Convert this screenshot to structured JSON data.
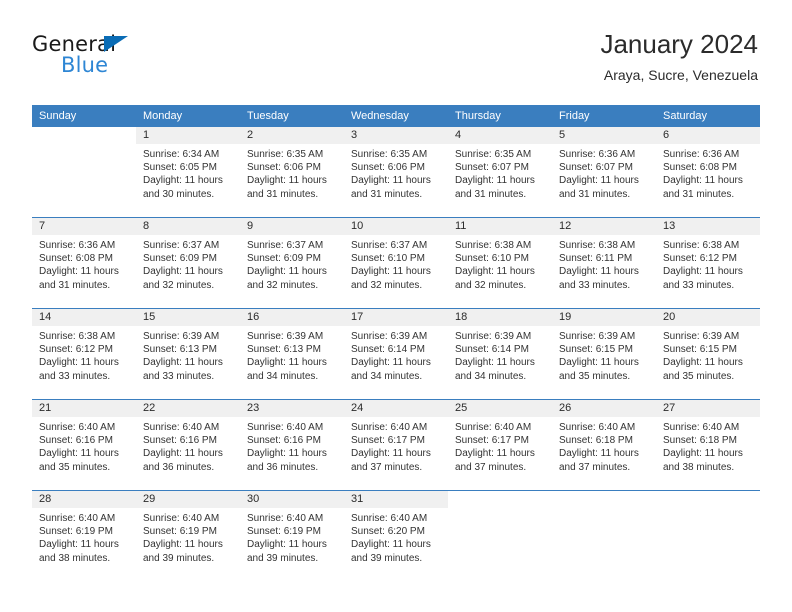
{
  "brand": {
    "name_top": "General",
    "name_bottom": "Blue",
    "triangle_color": "#0a6cb5",
    "blue_color": "#2e86d4"
  },
  "header": {
    "title": "January 2024",
    "subtitle": "Araya, Sucre, Venezuela"
  },
  "theme": {
    "header_row_bg": "#3a7ebf",
    "daynum_bg": "#f0f0f0",
    "grid_line": "#3a7ebf"
  },
  "weekdays": [
    "Sunday",
    "Monday",
    "Tuesday",
    "Wednesday",
    "Thursday",
    "Friday",
    "Saturday"
  ],
  "weeks": [
    [
      {
        "day": "",
        "sunrise": "",
        "sunset": "",
        "daylight1": "",
        "daylight2": "",
        "blank": true
      },
      {
        "day": "1",
        "sunrise": "Sunrise: 6:34 AM",
        "sunset": "Sunset: 6:05 PM",
        "daylight1": "Daylight: 11 hours",
        "daylight2": "and 30 minutes."
      },
      {
        "day": "2",
        "sunrise": "Sunrise: 6:35 AM",
        "sunset": "Sunset: 6:06 PM",
        "daylight1": "Daylight: 11 hours",
        "daylight2": "and 31 minutes."
      },
      {
        "day": "3",
        "sunrise": "Sunrise: 6:35 AM",
        "sunset": "Sunset: 6:06 PM",
        "daylight1": "Daylight: 11 hours",
        "daylight2": "and 31 minutes."
      },
      {
        "day": "4",
        "sunrise": "Sunrise: 6:35 AM",
        "sunset": "Sunset: 6:07 PM",
        "daylight1": "Daylight: 11 hours",
        "daylight2": "and 31 minutes."
      },
      {
        "day": "5",
        "sunrise": "Sunrise: 6:36 AM",
        "sunset": "Sunset: 6:07 PM",
        "daylight1": "Daylight: 11 hours",
        "daylight2": "and 31 minutes."
      },
      {
        "day": "6",
        "sunrise": "Sunrise: 6:36 AM",
        "sunset": "Sunset: 6:08 PM",
        "daylight1": "Daylight: 11 hours",
        "daylight2": "and 31 minutes."
      }
    ],
    [
      {
        "day": "7",
        "sunrise": "Sunrise: 6:36 AM",
        "sunset": "Sunset: 6:08 PM",
        "daylight1": "Daylight: 11 hours",
        "daylight2": "and 31 minutes."
      },
      {
        "day": "8",
        "sunrise": "Sunrise: 6:37 AM",
        "sunset": "Sunset: 6:09 PM",
        "daylight1": "Daylight: 11 hours",
        "daylight2": "and 32 minutes."
      },
      {
        "day": "9",
        "sunrise": "Sunrise: 6:37 AM",
        "sunset": "Sunset: 6:09 PM",
        "daylight1": "Daylight: 11 hours",
        "daylight2": "and 32 minutes."
      },
      {
        "day": "10",
        "sunrise": "Sunrise: 6:37 AM",
        "sunset": "Sunset: 6:10 PM",
        "daylight1": "Daylight: 11 hours",
        "daylight2": "and 32 minutes."
      },
      {
        "day": "11",
        "sunrise": "Sunrise: 6:38 AM",
        "sunset": "Sunset: 6:10 PM",
        "daylight1": "Daylight: 11 hours",
        "daylight2": "and 32 minutes."
      },
      {
        "day": "12",
        "sunrise": "Sunrise: 6:38 AM",
        "sunset": "Sunset: 6:11 PM",
        "daylight1": "Daylight: 11 hours",
        "daylight2": "and 33 minutes."
      },
      {
        "day": "13",
        "sunrise": "Sunrise: 6:38 AM",
        "sunset": "Sunset: 6:12 PM",
        "daylight1": "Daylight: 11 hours",
        "daylight2": "and 33 minutes."
      }
    ],
    [
      {
        "day": "14",
        "sunrise": "Sunrise: 6:38 AM",
        "sunset": "Sunset: 6:12 PM",
        "daylight1": "Daylight: 11 hours",
        "daylight2": "and 33 minutes."
      },
      {
        "day": "15",
        "sunrise": "Sunrise: 6:39 AM",
        "sunset": "Sunset: 6:13 PM",
        "daylight1": "Daylight: 11 hours",
        "daylight2": "and 33 minutes."
      },
      {
        "day": "16",
        "sunrise": "Sunrise: 6:39 AM",
        "sunset": "Sunset: 6:13 PM",
        "daylight1": "Daylight: 11 hours",
        "daylight2": "and 34 minutes."
      },
      {
        "day": "17",
        "sunrise": "Sunrise: 6:39 AM",
        "sunset": "Sunset: 6:14 PM",
        "daylight1": "Daylight: 11 hours",
        "daylight2": "and 34 minutes."
      },
      {
        "day": "18",
        "sunrise": "Sunrise: 6:39 AM",
        "sunset": "Sunset: 6:14 PM",
        "daylight1": "Daylight: 11 hours",
        "daylight2": "and 34 minutes."
      },
      {
        "day": "19",
        "sunrise": "Sunrise: 6:39 AM",
        "sunset": "Sunset: 6:15 PM",
        "daylight1": "Daylight: 11 hours",
        "daylight2": "and 35 minutes."
      },
      {
        "day": "20",
        "sunrise": "Sunrise: 6:39 AM",
        "sunset": "Sunset: 6:15 PM",
        "daylight1": "Daylight: 11 hours",
        "daylight2": "and 35 minutes."
      }
    ],
    [
      {
        "day": "21",
        "sunrise": "Sunrise: 6:40 AM",
        "sunset": "Sunset: 6:16 PM",
        "daylight1": "Daylight: 11 hours",
        "daylight2": "and 35 minutes."
      },
      {
        "day": "22",
        "sunrise": "Sunrise: 6:40 AM",
        "sunset": "Sunset: 6:16 PM",
        "daylight1": "Daylight: 11 hours",
        "daylight2": "and 36 minutes."
      },
      {
        "day": "23",
        "sunrise": "Sunrise: 6:40 AM",
        "sunset": "Sunset: 6:16 PM",
        "daylight1": "Daylight: 11 hours",
        "daylight2": "and 36 minutes."
      },
      {
        "day": "24",
        "sunrise": "Sunrise: 6:40 AM",
        "sunset": "Sunset: 6:17 PM",
        "daylight1": "Daylight: 11 hours",
        "daylight2": "and 37 minutes."
      },
      {
        "day": "25",
        "sunrise": "Sunrise: 6:40 AM",
        "sunset": "Sunset: 6:17 PM",
        "daylight1": "Daylight: 11 hours",
        "daylight2": "and 37 minutes."
      },
      {
        "day": "26",
        "sunrise": "Sunrise: 6:40 AM",
        "sunset": "Sunset: 6:18 PM",
        "daylight1": "Daylight: 11 hours",
        "daylight2": "and 37 minutes."
      },
      {
        "day": "27",
        "sunrise": "Sunrise: 6:40 AM",
        "sunset": "Sunset: 6:18 PM",
        "daylight1": "Daylight: 11 hours",
        "daylight2": "and 38 minutes."
      }
    ],
    [
      {
        "day": "28",
        "sunrise": "Sunrise: 6:40 AM",
        "sunset": "Sunset: 6:19 PM",
        "daylight1": "Daylight: 11 hours",
        "daylight2": "and 38 minutes."
      },
      {
        "day": "29",
        "sunrise": "Sunrise: 6:40 AM",
        "sunset": "Sunset: 6:19 PM",
        "daylight1": "Daylight: 11 hours",
        "daylight2": "and 39 minutes."
      },
      {
        "day": "30",
        "sunrise": "Sunrise: 6:40 AM",
        "sunset": "Sunset: 6:19 PM",
        "daylight1": "Daylight: 11 hours",
        "daylight2": "and 39 minutes."
      },
      {
        "day": "31",
        "sunrise": "Sunrise: 6:40 AM",
        "sunset": "Sunset: 6:20 PM",
        "daylight1": "Daylight: 11 hours",
        "daylight2": "and 39 minutes."
      },
      {
        "day": "",
        "sunrise": "",
        "sunset": "",
        "daylight1": "",
        "daylight2": "",
        "blank": true
      },
      {
        "day": "",
        "sunrise": "",
        "sunset": "",
        "daylight1": "",
        "daylight2": "",
        "blank": true
      },
      {
        "day": "",
        "sunrise": "",
        "sunset": "",
        "daylight1": "",
        "daylight2": "",
        "blank": true
      }
    ]
  ]
}
